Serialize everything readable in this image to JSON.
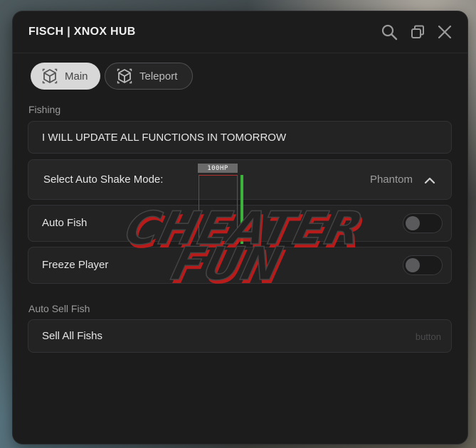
{
  "window": {
    "title": "FISCH | XNOX HUB",
    "title_icons": [
      "search-icon",
      "restore-icon",
      "close-icon"
    ]
  },
  "tabs": [
    {
      "label": "Main",
      "icon": "cube-icon",
      "active": true
    },
    {
      "label": "Teleport",
      "icon": "cube-icon",
      "active": false
    }
  ],
  "fishing": {
    "section_label": "Fishing",
    "notice": "I WILL UPDATE ALL FUNCTIONS IN TOMORROW",
    "shake_mode": {
      "label": "Select Auto Shake Mode:",
      "value": "Phantom"
    },
    "auto_fish": {
      "label": "Auto Fish",
      "enabled": false
    },
    "freeze_player": {
      "label": "Freeze Player",
      "enabled": false
    }
  },
  "auto_sell": {
    "section_label": "Auto Sell Fish",
    "sell_all": {
      "label": "Sell All Fishs",
      "hint": "button"
    }
  },
  "overlay": {
    "hp_tag": "100HP",
    "watermark": [
      "CHEATER",
      "FUN"
    ]
  },
  "colors": {
    "window_bg": "#1c1c1d",
    "row_bg": "#232324",
    "tab_active_bg": "#d8d8d8",
    "hp_bar": "#3cb43c",
    "esp_box": "#b03030",
    "watermark_shadow": "#d41a1a"
  }
}
